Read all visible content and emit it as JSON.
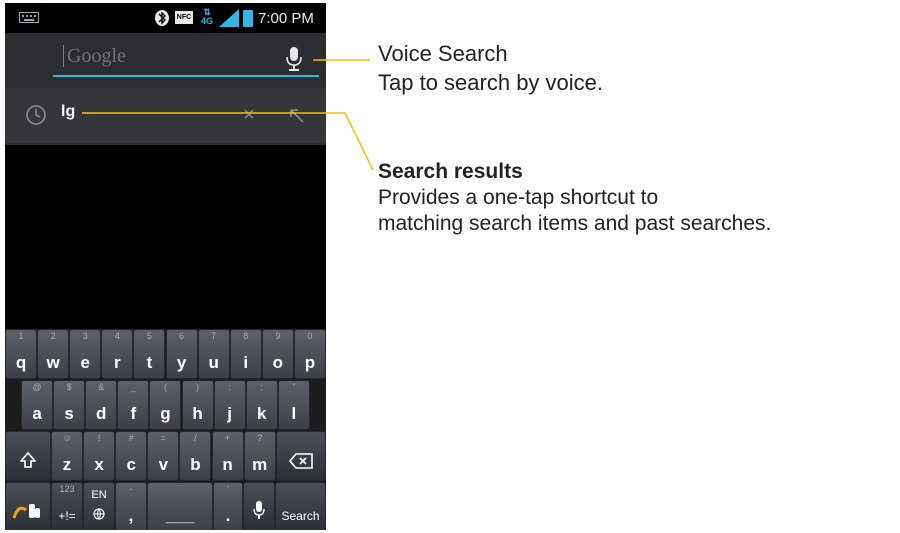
{
  "status_bar": {
    "time": "7:00 PM",
    "nfc_label": "NFC",
    "network_label": "4G",
    "icons": [
      "keyboard-icon",
      "bluetooth-icon",
      "nfc-icon",
      "4g-icon",
      "signal-icon",
      "battery-icon"
    ],
    "accent_color": "#33b5e5"
  },
  "search": {
    "placeholder": "Google",
    "mic_icon": "microphone-icon"
  },
  "suggestion": {
    "text": "lg",
    "history_icon": "clock-icon",
    "remove_label": "×",
    "refine_icon": "arrow-up-left-icon"
  },
  "keyboard": {
    "row1": [
      {
        "main": "q",
        "alt": "1"
      },
      {
        "main": "w",
        "alt": "2"
      },
      {
        "main": "e",
        "alt": "3"
      },
      {
        "main": "r",
        "alt": "4"
      },
      {
        "main": "t",
        "alt": "5"
      },
      {
        "main": "y",
        "alt": "6"
      },
      {
        "main": "u",
        "alt": "7"
      },
      {
        "main": "i",
        "alt": "8"
      },
      {
        "main": "o",
        "alt": "9"
      },
      {
        "main": "p",
        "alt": "0"
      }
    ],
    "row2": [
      {
        "main": "a",
        "alt": "@"
      },
      {
        "main": "s",
        "alt": "$"
      },
      {
        "main": "d",
        "alt": "&"
      },
      {
        "main": "f",
        "alt": "_"
      },
      {
        "main": "g",
        "alt": "("
      },
      {
        "main": "h",
        "alt": ")"
      },
      {
        "main": "j",
        "alt": ":"
      },
      {
        "main": "k",
        "alt": ";"
      },
      {
        "main": "l",
        "alt": "\""
      }
    ],
    "row3": [
      {
        "main": "z",
        "alt": "☺"
      },
      {
        "main": "x",
        "alt": "!"
      },
      {
        "main": "c",
        "alt": "#"
      },
      {
        "main": "v",
        "alt": "="
      },
      {
        "main": "b",
        "alt": "/"
      },
      {
        "main": "n",
        "alt": "+"
      },
      {
        "main": "m",
        "alt": "?"
      }
    ],
    "shift_icon": "shift-icon",
    "backspace_icon": "backspace-icon",
    "swipe_icon": "swipe-gesture-icon",
    "symbols_label": "+!=",
    "symbols_alt": "123",
    "lang_label": "EN",
    "lang_icon": "globe-icon",
    "comma_label": ",",
    "comma_alt": "-",
    "space_label": "___",
    "period_label": ".",
    "period_alt": "'",
    "voice_icon": "microphone-icon",
    "search_label": "Search"
  },
  "callouts": {
    "voice_title": "Voice Search",
    "voice_desc": "Tap to search by voice.",
    "results_title": "Search results",
    "results_desc_line1": "Provides a one-tap shortcut to",
    "results_desc_line2": "matching search items and past searches.",
    "line_color": "#f2c200"
  }
}
